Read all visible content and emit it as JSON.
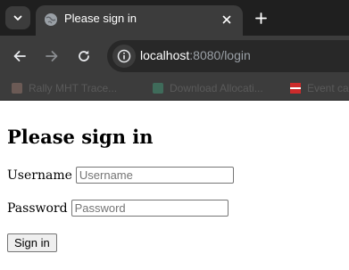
{
  "browser": {
    "tab": {
      "title": "Please sign in"
    },
    "address_bar": {
      "host": "localhost",
      "rest": ":8080/login"
    },
    "bookmarks": [
      {
        "label": "Rally MHT Trace..."
      },
      {
        "label": "Download Allocati..."
      },
      {
        "label": "Event ca..."
      }
    ],
    "colors": {
      "chrome_dark": "#1f1f1f",
      "toolbar": "#3c3c3c"
    }
  },
  "page": {
    "heading": "Please sign in",
    "form": {
      "username_label": "Username",
      "username_placeholder": "Username",
      "password_label": "Password",
      "password_placeholder": "Password",
      "submit_label": "Sign in"
    }
  }
}
